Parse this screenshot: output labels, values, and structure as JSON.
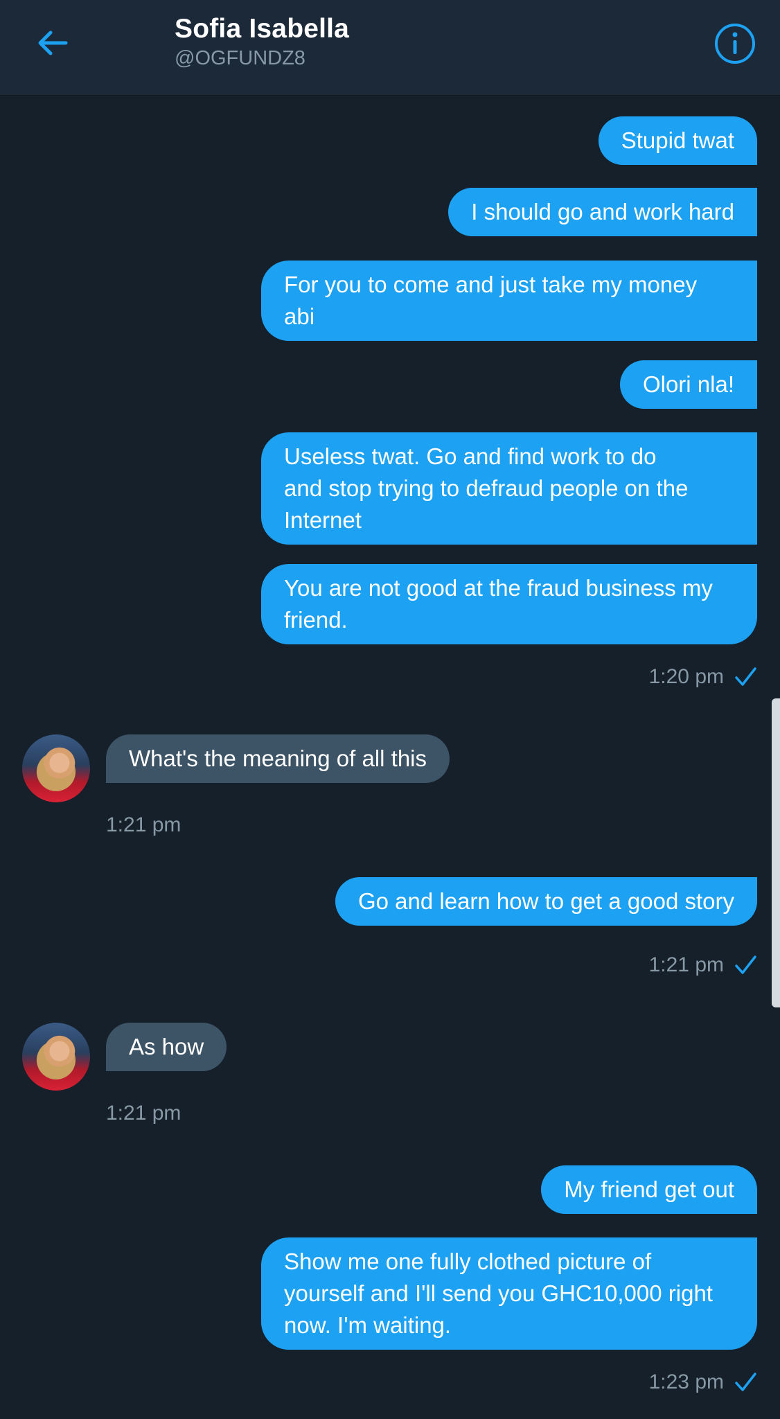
{
  "header": {
    "name": "Sofia Isabella",
    "handle": "@OGFUNDZ8"
  },
  "colors": {
    "accent": "#1da1f2",
    "background": "#15202b",
    "incoming_bubble": "#3d5466",
    "secondary_text": "#8899a6"
  },
  "messages": [
    {
      "text": "Stupid twat"
    },
    {
      "text": "I should go and work hard"
    },
    {
      "text": "For you to come and just take my money\nabi"
    },
    {
      "text": "Olori nla!"
    },
    {
      "text": "Useless twat. Go and find work to do\nand stop trying to defraud people on the\nInternet"
    },
    {
      "text": "You are not good at the fraud business my\nfriend."
    },
    {
      "text": "What's the meaning of all this"
    },
    {
      "text": "Go and learn how to get a good story"
    },
    {
      "text": "As how"
    },
    {
      "text": "My friend get out"
    },
    {
      "text": "Show me one fully clothed picture of\nyourself and I'll send you GHC10,000 right\nnow. I'm waiting."
    }
  ],
  "timestamps": [
    "1:20 pm",
    "1:21 pm",
    "1:21 pm",
    "1:21 pm",
    "1:23 pm"
  ]
}
